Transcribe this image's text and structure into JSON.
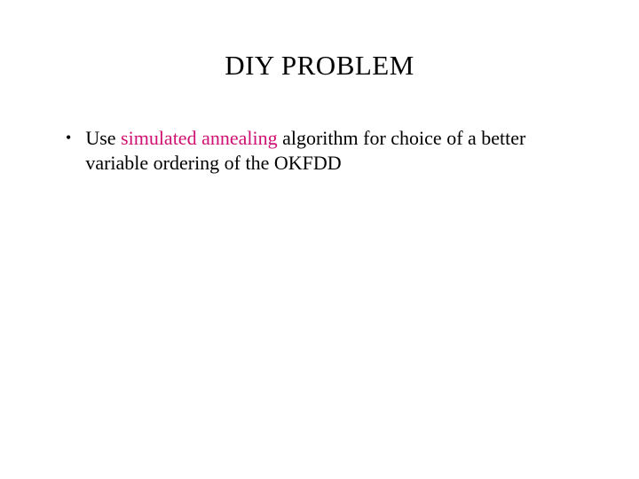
{
  "slide": {
    "title": "DIY PROBLEM",
    "bullets": [
      {
        "prefix": "Use ",
        "highlight": "simulated annealing",
        "suffix": " algorithm for choice of a better variable ordering of the OKFDD"
      }
    ]
  }
}
